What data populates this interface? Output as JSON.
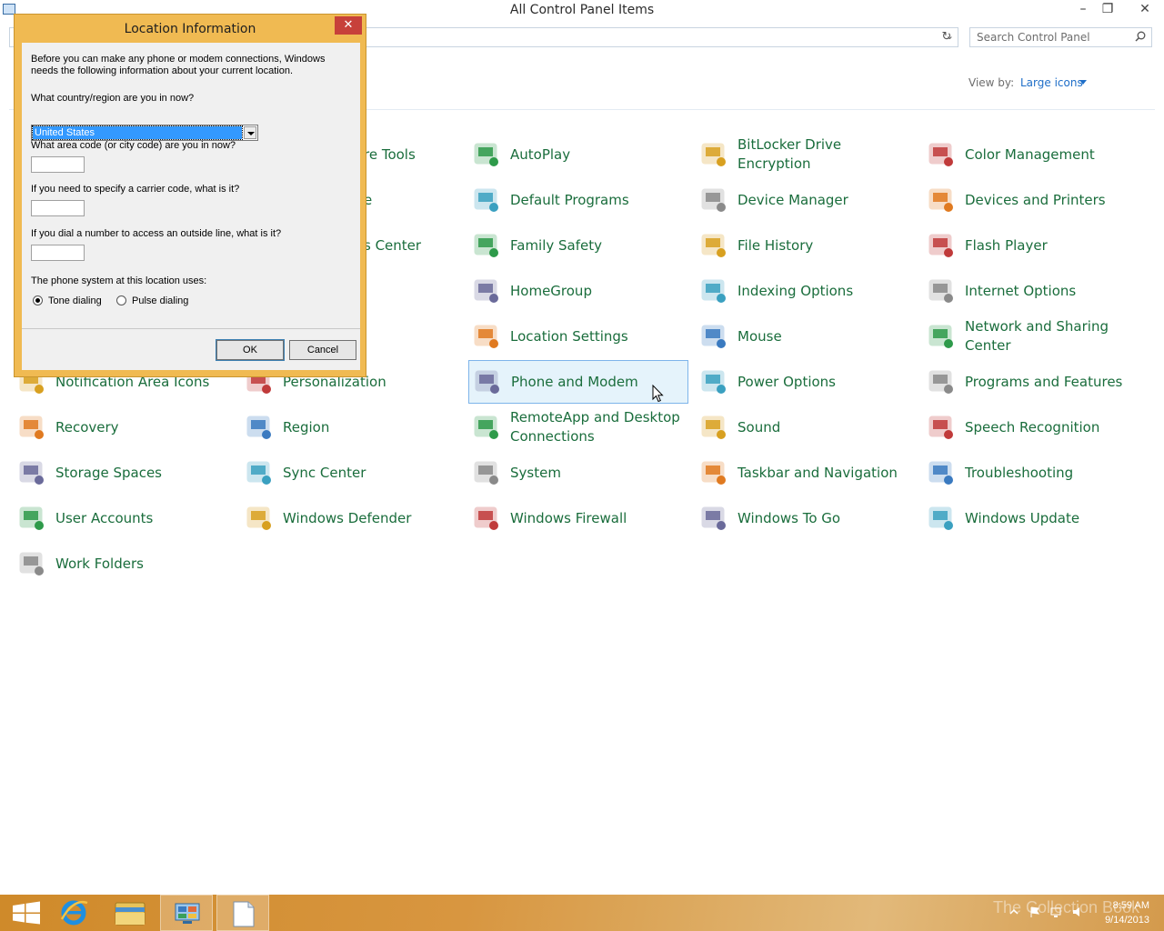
{
  "window": {
    "title": "All Control Panel Items",
    "min_label": "–",
    "max_label": "❐",
    "close_label": "✕"
  },
  "search": {
    "placeholder": "Search Control Panel"
  },
  "view": {
    "label": "View by:",
    "value": "Large icons"
  },
  "items": [
    {
      "label": "re Tools",
      "icon": "admin-tools-icon"
    },
    {
      "label": "AutoPlay",
      "icon": "autoplay-icon"
    },
    {
      "label": "BitLocker Drive Encryption",
      "icon": "bitlocker-icon"
    },
    {
      "label": "Color Management",
      "icon": "color-management-icon"
    },
    {
      "label": "e",
      "icon": "date-time-icon"
    },
    {
      "label": "Default Programs",
      "icon": "default-programs-icon"
    },
    {
      "label": "Device Manager",
      "icon": "device-manager-icon"
    },
    {
      "label": "Devices and Printers",
      "icon": "devices-printers-icon"
    },
    {
      "label": "s Center",
      "icon": "ease-of-access-icon"
    },
    {
      "label": "Family Safety",
      "icon": "family-safety-icon"
    },
    {
      "label": "File History",
      "icon": "file-history-icon"
    },
    {
      "label": "Flash Player",
      "icon": "flash-player-icon"
    },
    {
      "label": "HomeGroup",
      "icon": "homegroup-icon"
    },
    {
      "label": "Indexing Options",
      "icon": "indexing-options-icon"
    },
    {
      "label": "Internet Options",
      "icon": "internet-options-icon"
    },
    {
      "label": "Location Settings",
      "icon": "location-settings-icon"
    },
    {
      "label": "Mouse",
      "icon": "mouse-icon"
    },
    {
      "label": "Network and Sharing Center",
      "icon": "network-sharing-icon"
    },
    {
      "label": "Notification Area Icons",
      "icon": "notification-area-icon"
    },
    {
      "label": "Personalization",
      "icon": "personalization-icon"
    },
    {
      "label": "Phone and Modem",
      "icon": "phone-modem-icon"
    },
    {
      "label": "Power Options",
      "icon": "power-options-icon"
    },
    {
      "label": "Programs and Features",
      "icon": "programs-features-icon"
    },
    {
      "label": "Recovery",
      "icon": "recovery-icon"
    },
    {
      "label": "Region",
      "icon": "region-icon"
    },
    {
      "label": "RemoteApp and Desktop Connections",
      "icon": "remoteapp-icon"
    },
    {
      "label": "Sound",
      "icon": "sound-icon"
    },
    {
      "label": "Speech Recognition",
      "icon": "speech-recognition-icon"
    },
    {
      "label": "Storage Spaces",
      "icon": "storage-spaces-icon"
    },
    {
      "label": "Sync Center",
      "icon": "sync-center-icon"
    },
    {
      "label": "System",
      "icon": "system-icon"
    },
    {
      "label": "Taskbar and Navigation",
      "icon": "taskbar-navigation-icon"
    },
    {
      "label": "Troubleshooting",
      "icon": "troubleshooting-icon"
    },
    {
      "label": "User Accounts",
      "icon": "user-accounts-icon"
    },
    {
      "label": "Windows Defender",
      "icon": "windows-defender-icon"
    },
    {
      "label": "Windows Firewall",
      "icon": "windows-firewall-icon"
    },
    {
      "label": "Windows To Go",
      "icon": "windows-to-go-icon"
    },
    {
      "label": "Windows Update",
      "icon": "windows-update-icon"
    },
    {
      "label": "Work Folders",
      "icon": "work-folders-icon"
    }
  ],
  "dialog": {
    "title": "Location Information",
    "close_label": "✕",
    "intro": "Before you can make any phone or modem connections, Windows needs the following information about your current location.",
    "country_question": "What country/region are you in now?",
    "country_value": "United States",
    "area_question": "What area code (or city code) are you in now?",
    "area_value": "",
    "carrier_question": "If you need to specify a carrier code, what is it?",
    "carrier_value": "",
    "outside_question": "If you dial a number to access an outside line, what is it?",
    "outside_value": "",
    "phone_system_label": "The phone system at this location uses:",
    "tone_label": "Tone dialing",
    "pulse_label": "Pulse dialing",
    "selected_dialing": "Tone dialing",
    "ok_label": "OK",
    "cancel_label": "Cancel"
  },
  "taskbar": {
    "buttons": [
      "start-button",
      "internet-explorer",
      "file-explorer",
      "control-panel",
      "document"
    ],
    "active": "document",
    "time": "8:59 AM",
    "date": "9/14/2013",
    "watermark": "The Collection Book"
  },
  "colors": {
    "accent": "#f0ba52",
    "link_green": "#1a6d3c",
    "link_blue": "#1e6ec8",
    "taskbar": "#d89640"
  }
}
